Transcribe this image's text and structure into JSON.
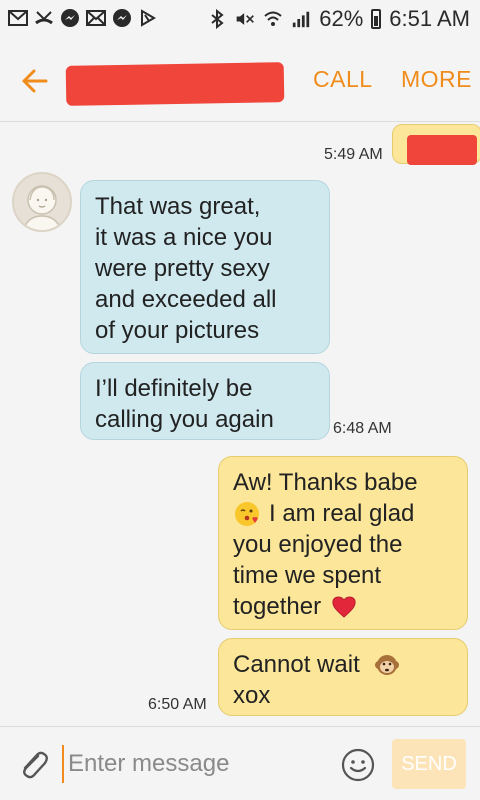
{
  "status_bar": {
    "battery": "62%",
    "time": "6:51 AM",
    "icons": [
      "gmail-icon",
      "missed-call-icon",
      "messenger-icon",
      "mail-icon",
      "messenger-icon",
      "flag-icon",
      "bluetooth-icon",
      "mute-icon",
      "wifi-icon",
      "signal-icon",
      "battery-icon"
    ]
  },
  "header": {
    "call_label": "CALL",
    "more_label": "MORE",
    "accent_color": "#f08c1c",
    "redaction_color": "#f0453a"
  },
  "messages": [
    {
      "direction": "timestamp",
      "time": "5:49 AM"
    },
    {
      "direction": "incoming",
      "text_lines": [
        "That was great,",
        "it was a nice you",
        "were pretty sexy",
        "and exceeded all",
        "of your pictures"
      ]
    },
    {
      "direction": "incoming",
      "text_lines": [
        "I’ll definitely be",
        "calling you again"
      ],
      "time": "6:48 AM"
    },
    {
      "direction": "outgoing",
      "text_lines": [
        "Aw! Thanks babe",
        "I am real glad",
        "you enjoyed the",
        "time we spent",
        "together"
      ]
    },
    {
      "direction": "outgoing",
      "text_lines": [
        "Cannot wait",
        "xox"
      ],
      "time": "6:50 AM"
    }
  ],
  "input": {
    "placeholder": "Enter message",
    "send_label": "SEND"
  }
}
